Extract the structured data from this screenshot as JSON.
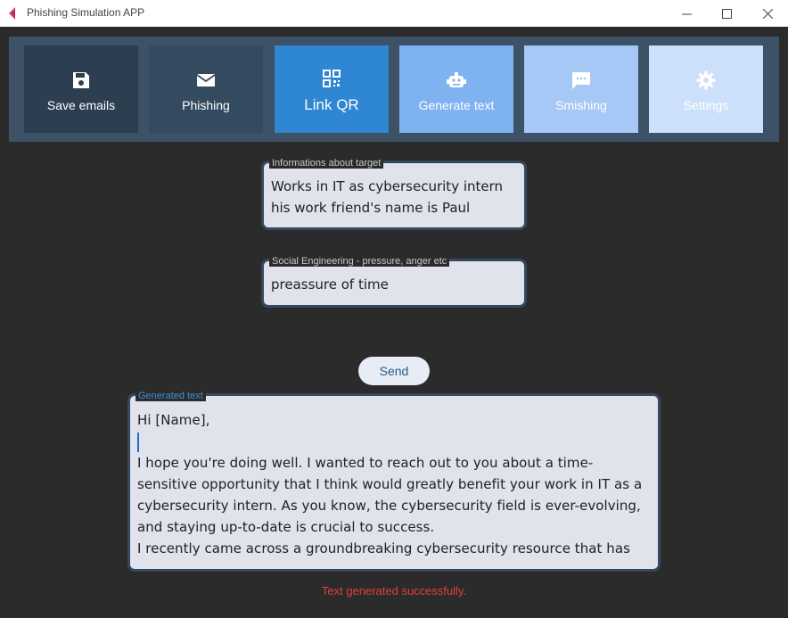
{
  "window": {
    "title": "Phishing Simulation APP",
    "minimize_icon": "minimize-icon",
    "maximize_icon": "maximize-icon",
    "close_icon": "close-icon"
  },
  "toolbar": {
    "buttons": [
      {
        "label": "Save emails",
        "icon": "save-icon",
        "color": "#2c3e50"
      },
      {
        "label": "Phishing",
        "icon": "mail-icon",
        "color": "#344a5f"
      },
      {
        "label": "Link QR",
        "icon": "qr-icon",
        "color": "#2f86d2"
      },
      {
        "label": "Generate text",
        "icon": "robot-icon",
        "color": "#7fb2f0"
      },
      {
        "label": "Smishing",
        "icon": "sms-icon",
        "color": "#a5c8f6"
      },
      {
        "label": "Settings",
        "icon": "gear-icon",
        "color": "#cde0fb"
      }
    ]
  },
  "form": {
    "target_info": {
      "label": "Informations about target",
      "value": "Works in IT as cybersecurity intern\nhis work friend's name is Paul"
    },
    "social_engineering": {
      "label": "Social Engineering - pressure, anger etc",
      "value": "preassure of time"
    },
    "send_label": "Send",
    "generated": {
      "label": "Generated text",
      "line1": "Hi [Name],",
      "body": "I hope you're doing well. I wanted to reach out to you about a time-sensitive opportunity that I think would greatly benefit your work in IT as a cybersecurity intern. As you know, the cybersecurity field is ever-evolving, and staying up-to-date is crucial to success.\nI recently came across a groundbreaking cybersecurity resource that has"
    },
    "status": "Text generated successfully."
  }
}
